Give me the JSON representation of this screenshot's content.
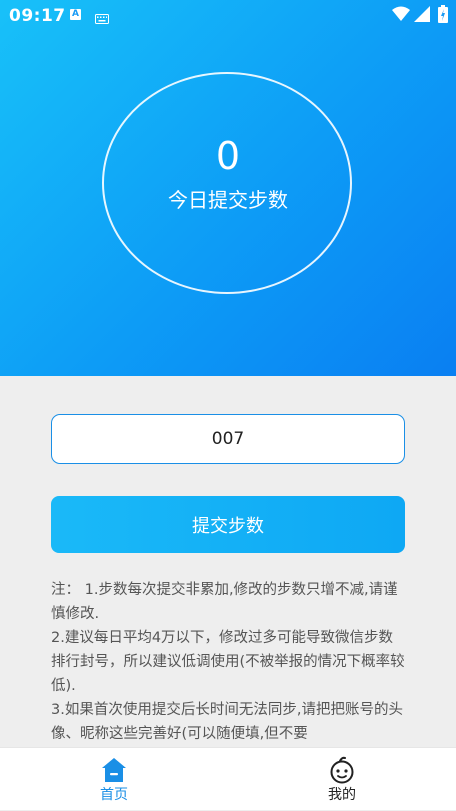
{
  "status_bar": {
    "time": "09:17",
    "a_icon_text": "A"
  },
  "hero": {
    "count_value": "0",
    "count_label": "今日提交步数"
  },
  "form": {
    "input_value": "007",
    "submit_label": "提交步数"
  },
  "notes": {
    "line1": "注： 1.步数每次提交非累加,修改的步数只增不减,请谨慎修改.",
    "line2": "2.建议每日平均4万以下，修改过多可能导致微信步数排行封号，所以建议低调使用(不被举报的情况下概率较低).",
    "line3": "3.如果首次使用提交后长时间无法同步,请把把账号的头像、昵称这些完善好(可以随便填,但不要"
  },
  "bottom_nav": {
    "home_label": "首页",
    "mine_label": "我的"
  },
  "colors": {
    "accent": "#1a8fe6",
    "hero_start": "#18c1f9",
    "hero_end": "#0a7ff2",
    "button": "#12b0f6"
  },
  "icons": {
    "home": "home-icon",
    "mine": "face-icon",
    "wifi": "wifi-icon",
    "signal": "signal-icon",
    "battery": "battery-icon",
    "keyboard": "keyboard-icon"
  }
}
